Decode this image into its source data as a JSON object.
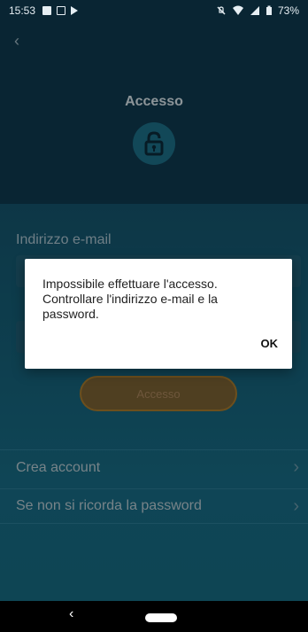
{
  "status_bar": {
    "time": "15:53",
    "battery": "73%"
  },
  "header": {
    "back_chevron": "‹",
    "title": "Accesso",
    "lock_icon": "lock-open-icon"
  },
  "form": {
    "email_label": "Indirizzo e-mail",
    "login_button": "Accesso"
  },
  "links": [
    {
      "label": "Crea account"
    },
    {
      "label": "Se non si ricorda la password"
    }
  ],
  "dialog": {
    "message": "Impossibile effettuare l'accesso. Controllare l'indirizzo e-mail e la password.",
    "ok": "OK"
  },
  "nav": {
    "back_symbol": "‹"
  },
  "colors": {
    "header_bg": "#0e3a4f",
    "content_bg": "#14546c",
    "button_orange": "#a77a2d",
    "dialog_bg": "#ffffff"
  }
}
